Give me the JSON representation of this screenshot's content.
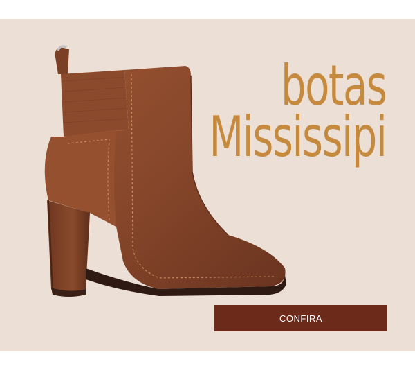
{
  "promo": {
    "title_line1": "botas",
    "title_line2": "Mississipi",
    "cta_label": "CONFIRA"
  },
  "colors": {
    "background": "#ecdfd5",
    "title": "#c58a3e",
    "button": "#6b2a1a",
    "button_text": "#ffffff",
    "boot_leather": "#8a4a2b"
  },
  "image": {
    "icon": "ankle-boot-image"
  }
}
